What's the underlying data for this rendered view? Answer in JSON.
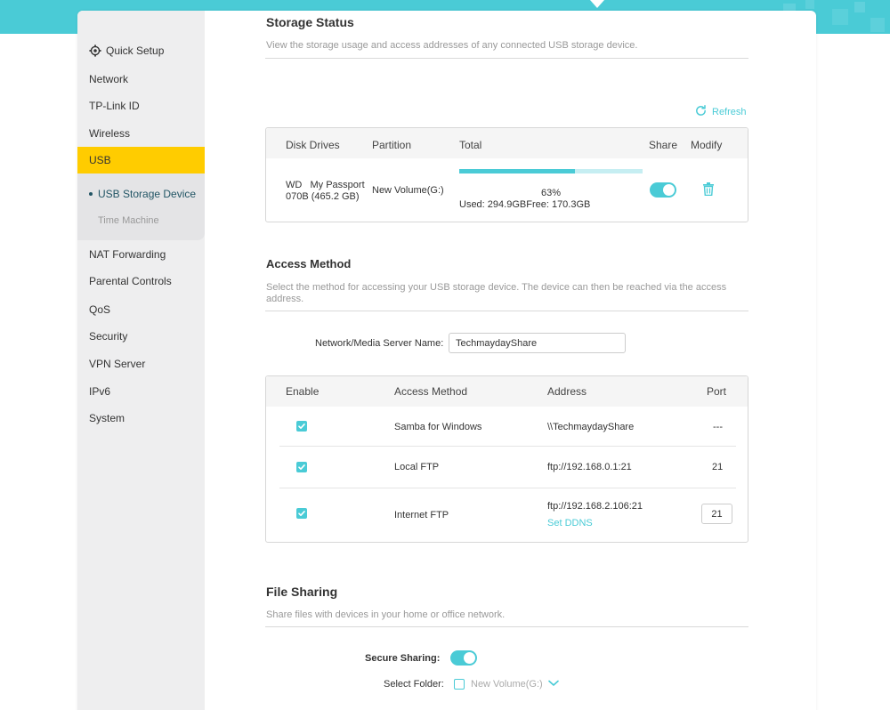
{
  "sidebar": {
    "items": [
      {
        "label": "Quick Setup"
      },
      {
        "label": "Network"
      },
      {
        "label": "TP-Link ID"
      },
      {
        "label": "Wireless"
      },
      {
        "label": "USB"
      },
      {
        "label": "NAT Forwarding"
      },
      {
        "label": "Parental Controls"
      },
      {
        "label": "QoS"
      },
      {
        "label": "Security"
      },
      {
        "label": "VPN Server"
      },
      {
        "label": "IPv6"
      },
      {
        "label": "System"
      }
    ],
    "usb_submenu": [
      {
        "label": "USB Storage Device",
        "active": true
      },
      {
        "label": "Time Machine",
        "active": false
      }
    ]
  },
  "storage_status": {
    "title": "Storage Status",
    "description": "View the storage usage and access addresses of any connected USB storage device.",
    "refresh_label": "Refresh",
    "headers": {
      "disk": "Disk Drives",
      "partition": "Partition",
      "total": "Total",
      "share": "Share",
      "modify": "Modify"
    },
    "row": {
      "disk_line1": "WD   My Passport",
      "disk_line2": "070B (465.2 GB)",
      "partition": "New Volume(G:)",
      "percent_label": "63%",
      "percent_value": 0.63,
      "used": "Used: 294.9GB",
      "free": "Free: 170.3GB",
      "share_on": true
    }
  },
  "access_method": {
    "title": "Access Method",
    "description": "Select the method for accessing your USB storage device. The device can then be reached via the access address.",
    "server_name_label": "Network/Media Server Name:",
    "server_name_value": "TechmaydayShare",
    "headers": {
      "enable": "Enable",
      "method": "Access Method",
      "address": "Address",
      "port": "Port"
    },
    "rows": [
      {
        "enabled": true,
        "method": "Samba for Windows",
        "address": "\\\\TechmaydayShare",
        "port": "---"
      },
      {
        "enabled": true,
        "method": "Local FTP",
        "address": "ftp://192.168.0.1:21",
        "port": "21"
      },
      {
        "enabled": true,
        "method": "Internet FTP",
        "address": "ftp://192.168.2.106:21",
        "port": "21",
        "link": "Set DDNS"
      }
    ]
  },
  "file_sharing": {
    "title": "File Sharing",
    "description": "Share files with devices in your home or office network.",
    "secure_sharing_label": "Secure Sharing:",
    "secure_sharing_on": true,
    "select_folder_label": "Select Folder:",
    "folder_option": "New Volume(G:)"
  },
  "colors": {
    "accent": "#4acbd6",
    "active_nav": "#ffcc00",
    "sidebar_bg": "#eeeeef"
  }
}
